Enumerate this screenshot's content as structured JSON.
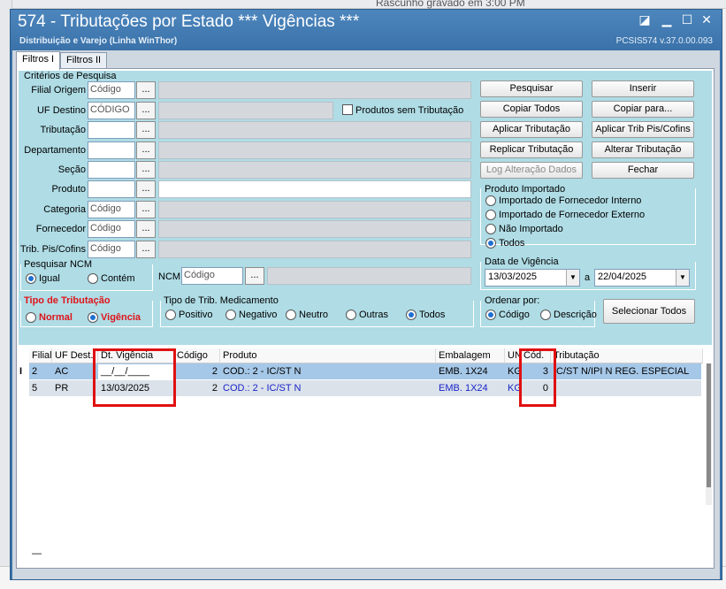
{
  "background": {
    "top_text": "Rascunho gravado em 3:00 PM"
  },
  "window": {
    "title": "574 - Tributações por Estado *** Vigências ***",
    "subtitle": "Distribuição e Varejo (Linha WinThor)",
    "version": "PCSIS574  v.37.0.00.093"
  },
  "tabs": [
    "Filtros I",
    "Filtros II"
  ],
  "criteria": {
    "group_label": "Critérios de Pesquisa",
    "filial_origem": {
      "label": "Filial Origem",
      "placeholder": "Código"
    },
    "uf_destino": {
      "label": "UF Destino",
      "placeholder": "CÓDIGO"
    },
    "produtos_sem_trib": "Produtos sem Tributação",
    "tributacao": {
      "label": "Tributação"
    },
    "departamento": {
      "label": "Departamento"
    },
    "secao": {
      "label": "Seção"
    },
    "produto": {
      "label": "Produto"
    },
    "categoria": {
      "label": "Categoria",
      "placeholder": "Código"
    },
    "fornecedor": {
      "label": "Fornecedor",
      "placeholder": "Código"
    },
    "trib_pis_cofins": {
      "label": "Trib. Pis/Cofins",
      "placeholder": "Código"
    },
    "dots": "..."
  },
  "buttons": {
    "pesquisar": "Pesquisar",
    "inserir": "Inserir",
    "copiar_todos": "Copiar Todos",
    "copiar_para": "Copiar para...",
    "aplicar_trib": "Aplicar Tributação",
    "aplicar_trib_pis": "Aplicar Trib Pis/Cofins",
    "replicar_trib": "Replicar Tributação",
    "alterar_trib": "Alterar Tributação",
    "log_alteracao": "Log Alteração Dados",
    "fechar": "Fechar",
    "selecionar_todos": "Selecionar Todos"
  },
  "produto_importado": {
    "label": "Produto Importado",
    "options": [
      "Importado de Fornecedor Interno",
      "Importado de Fornecedor Externo",
      "Não Importado",
      "Todos"
    ],
    "selected": 3
  },
  "pesquisar_ncm": {
    "label": "Pesquisar NCM",
    "options": [
      "Igual",
      "Contém"
    ],
    "selected": 0,
    "ncm_label": "NCM",
    "ncm_placeholder": "Código"
  },
  "data_vigencia": {
    "label": "Data de Vigência",
    "from": "13/03/2025",
    "sep": "a",
    "to": "22/04/2025"
  },
  "tipo_tributacao": {
    "label": "Tipo de Tributação",
    "options": [
      "Normal",
      "Vigência"
    ],
    "selected": 1
  },
  "tipo_trib_medicamento": {
    "label": "Tipo de Trib. Medicamento",
    "options": [
      "Positivo",
      "Negativo",
      "Neutro",
      "Outras",
      "Todos"
    ],
    "selected": 4
  },
  "ordenar_por": {
    "label": "Ordenar por:",
    "options": [
      "Código",
      "Descrição"
    ],
    "selected": 0
  },
  "grid": {
    "columns": [
      "Filial",
      "UF Dest.",
      "Dt. Vigência",
      "Código",
      "Produto",
      "Embalagem",
      "UN",
      "Cód.",
      "Tributação"
    ],
    "rows": [
      {
        "indicator": "I",
        "filial": "2",
        "uf": "AC",
        "dt_vigencia": "__/__/____",
        "codigo": "2",
        "produto": "COD.: 2 - IC/ST N",
        "embalagem": "EMB. 1X24",
        "un": "KG",
        "cod": "3",
        "tributacao": "IC/ST N/IPI N REG. ESPECIAL"
      },
      {
        "indicator": "",
        "filial": "5",
        "uf": "PR",
        "dt_vigencia": "13/03/2025",
        "codigo": "2",
        "produto": "COD.: 2 - IC/ST N",
        "embalagem": "EMB. 1X24",
        "un": "KG",
        "cod": "0",
        "tributacao": ""
      }
    ],
    "footer": "—"
  }
}
